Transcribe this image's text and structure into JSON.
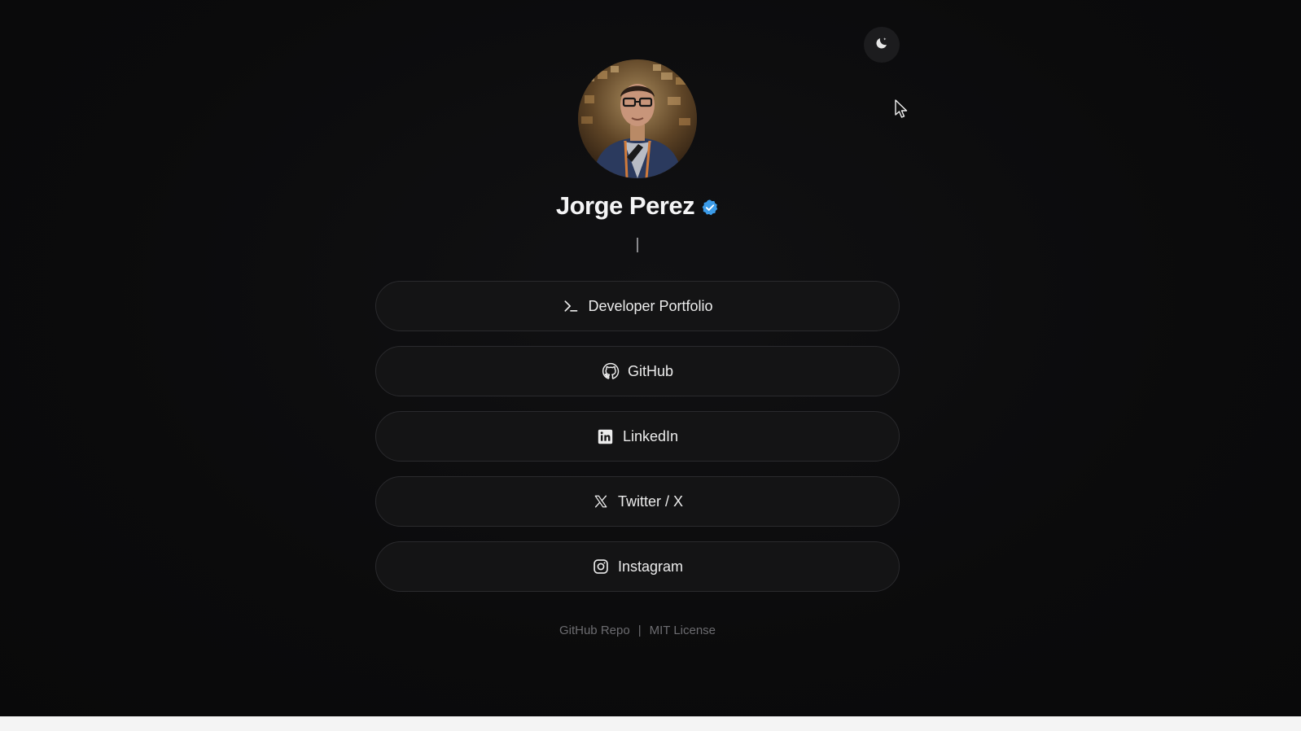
{
  "profile": {
    "name": "Jorge Perez",
    "verified_icon": "verified-badge-icon",
    "caret": "|"
  },
  "theme_toggle": {
    "icon": "moon-icon"
  },
  "links": [
    {
      "label": "Developer Portfolio",
      "icon": "terminal-icon"
    },
    {
      "label": "GitHub",
      "icon": "github-icon"
    },
    {
      "label": "LinkedIn",
      "icon": "linkedin-icon"
    },
    {
      "label": "Twitter / X",
      "icon": "x-icon"
    },
    {
      "label": "Instagram",
      "icon": "instagram-icon"
    }
  ],
  "footer": {
    "repo_label": "GitHub Repo",
    "separator": "|",
    "license_label": "MIT License"
  },
  "colors": {
    "background": "#0b0b0c",
    "button_bg": "#141415",
    "button_border": "#2a2a2d",
    "verified": "#3b9be8",
    "footer_text": "#6c6c70"
  }
}
